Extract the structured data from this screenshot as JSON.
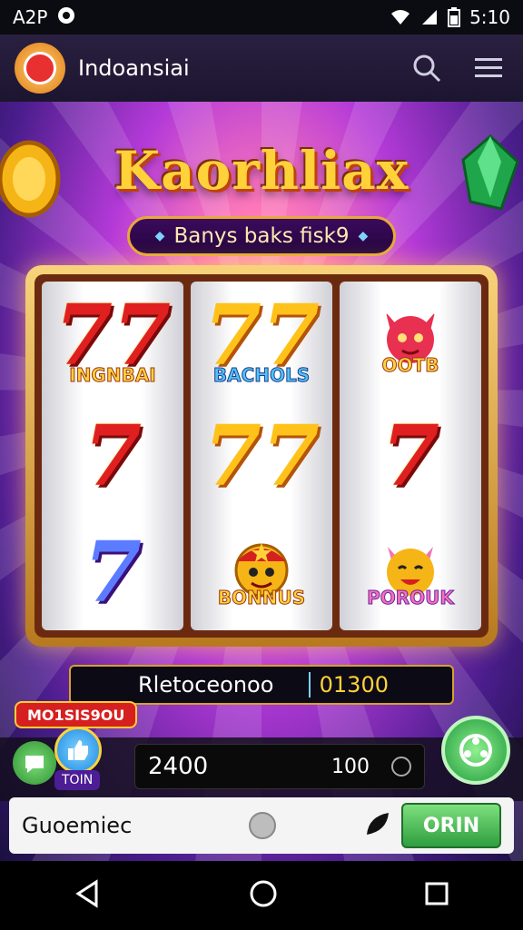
{
  "status_bar": {
    "carrier": "A2P",
    "time": "5:10"
  },
  "header": {
    "app_name": "Indoansiai"
  },
  "game": {
    "title": "Kaorhliax",
    "subtitle": "Banys baks fisk9",
    "reels": [
      [
        {
          "kind": "seven",
          "color": "red",
          "label": "INGNBAI"
        },
        {
          "kind": "seven",
          "color": "red",
          "label": ""
        },
        {
          "kind": "seven",
          "color": "blue",
          "label": ""
        }
      ],
      [
        {
          "kind": "seven",
          "color": "gold",
          "label": "BACHOLS"
        },
        {
          "kind": "seven",
          "color": "gold",
          "label": ""
        },
        {
          "kind": "face",
          "label": "BONNUS"
        }
      ],
      [
        {
          "kind": "face",
          "label": "OOTB"
        },
        {
          "kind": "seven",
          "color": "red",
          "label": ""
        },
        {
          "kind": "face",
          "label": "POROUK"
        }
      ]
    ],
    "info_label": "Rletoceonoo",
    "info_value": "01300",
    "promo_tag": "MO1SIS9OU",
    "vip_tag": "TOIN",
    "credit": "2400",
    "bet": "100"
  },
  "bottom_panel": {
    "label": "Guoemiec",
    "play_button": "ORIN"
  },
  "colors": {
    "accent_gold": "#ffd23a",
    "spin_green": "#1f9a3a",
    "header_bg": "#2a2040"
  },
  "icons": [
    "signal-icon",
    "search-icon",
    "menu-icon",
    "chat-icon",
    "thumbs-up-icon",
    "spin-icon",
    "leaf-icon",
    "back-icon",
    "home-icon",
    "recents-icon"
  ]
}
